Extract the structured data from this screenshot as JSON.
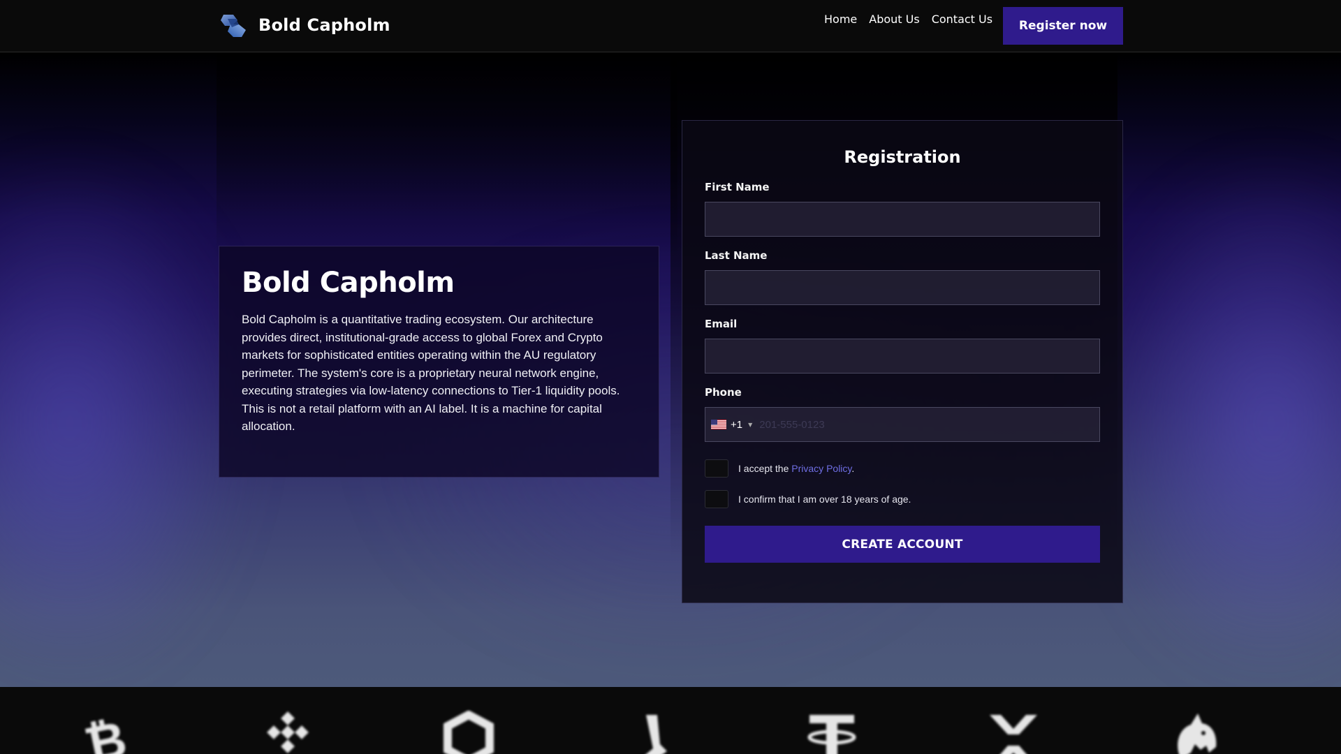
{
  "brand": {
    "name": "Bold Capholm",
    "logo_icon": "bold-capholm-logo-icon"
  },
  "nav": {
    "items": [
      {
        "label": "Home"
      },
      {
        "label": "About Us"
      },
      {
        "label": "Contact Us"
      }
    ],
    "register_label": "Register now"
  },
  "about": {
    "title": "Bold Capholm",
    "text": "Bold Capholm is a quantitative trading ecosystem. Our architecture provides direct, institutional-grade access to global Forex and Crypto markets for sophisticated entities operating within the AU regulatory perimeter. The system's core is a proprietary neural network engine, executing strategies via low-latency connections to Tier-1 liquidity pools. This is not a retail platform with an AI label. It is a machine for capital allocation."
  },
  "registration": {
    "title": "Registration",
    "first_name_label": "First Name",
    "first_name_value": "",
    "last_name_label": "Last Name",
    "last_name_value": "",
    "email_label": "Email",
    "email_value": "",
    "phone_label": "Phone",
    "phone_country_flag": "us-flag-icon",
    "phone_dial_code": "+1",
    "phone_placeholder": "201-555-0123",
    "privacy_prefix": "I accept the ",
    "privacy_link": "Privacy Policy",
    "privacy_suffix": ".",
    "privacy_checked": false,
    "age_label": "I confirm that I am over 18 years of age.",
    "age_checked": false,
    "submit_label": "CREATE ACCOUNT"
  },
  "crypto_icons": [
    "bitcoin-icon",
    "binance-icon",
    "chainlink-icon",
    "solana-icon",
    "tether-icon",
    "xrp-icon",
    "uniswap-icon"
  ],
  "colors": {
    "accent": "#2f1b8c",
    "link": "#6f6ee3",
    "header_bg": "#0a0a0a"
  }
}
